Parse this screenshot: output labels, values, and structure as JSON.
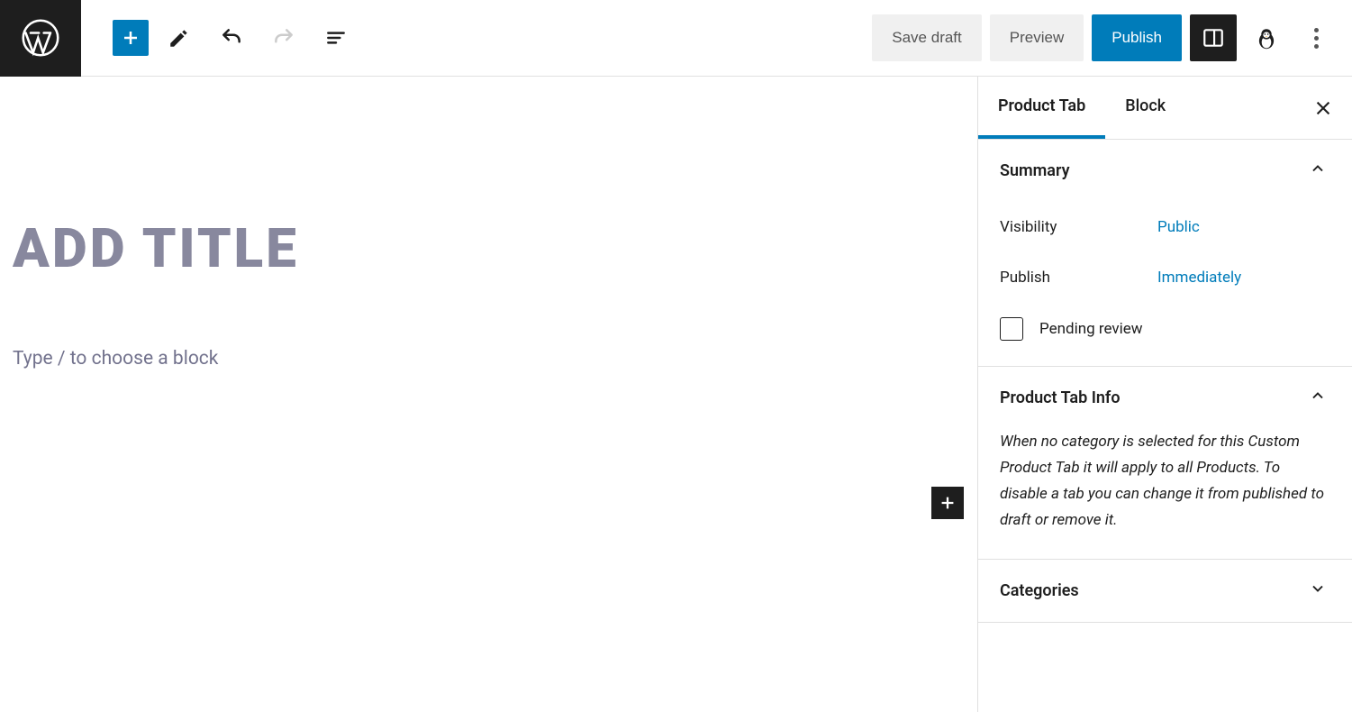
{
  "topbar": {
    "save_draft_label": "Save draft",
    "preview_label": "Preview",
    "publish_label": "Publish"
  },
  "editor": {
    "title_placeholder": "Add title",
    "block_placeholder": "Type / to choose a block"
  },
  "sidebar": {
    "tabs": {
      "product_tab": "Product Tab",
      "block": "Block"
    },
    "summary": {
      "title": "Summary",
      "visibility_label": "Visibility",
      "visibility_value": "Public",
      "publish_label": "Publish",
      "publish_value": "Immediately",
      "pending_review_label": "Pending review"
    },
    "product_tab_info": {
      "title": "Product Tab Info",
      "text": "When no category is selected for this Custom Product Tab it will apply to all Products. To disable a tab you can change it from published to draft or remove it."
    },
    "categories": {
      "title": "Categories"
    }
  }
}
